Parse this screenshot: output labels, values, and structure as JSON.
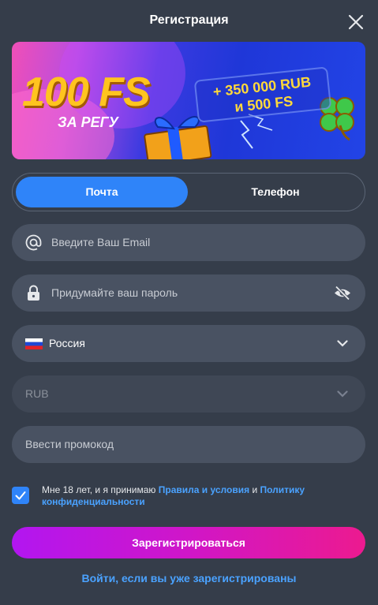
{
  "header": {
    "title": "Регистрация",
    "close_icon": "close-icon"
  },
  "banner": {
    "headline": "100 FS",
    "subline": "ЗА РЕГУ",
    "bonus_line1": "+ 350 000 RUB",
    "bonus_line2": "и 500 FS"
  },
  "tabs": [
    {
      "label": "Почта",
      "active": true
    },
    {
      "label": "Телефон",
      "active": false
    }
  ],
  "form": {
    "email_placeholder": "Введите Ваш Email",
    "password_placeholder": "Придумайте ваш пароль",
    "country_value": "Россия",
    "currency_value": "RUB",
    "promo_placeholder": "Ввести промокод"
  },
  "terms": {
    "checked": true,
    "prefix": "Мне 18 лет, и я принимаю",
    "rules_link": "Правила и условия",
    "and": "и",
    "policy_link": "Политику конфиденциальности"
  },
  "actions": {
    "submit_label": "Зарегистрироваться",
    "login_link": "Войти, если вы уже зарегистрированы"
  },
  "colors": {
    "background": "#353d4a",
    "field": "#495262",
    "accent_blue": "#2f84f9",
    "link_blue": "#4aa2ff",
    "submit_gradient_start": "#b216f0",
    "submit_gradient_end": "#ec1a8f"
  }
}
